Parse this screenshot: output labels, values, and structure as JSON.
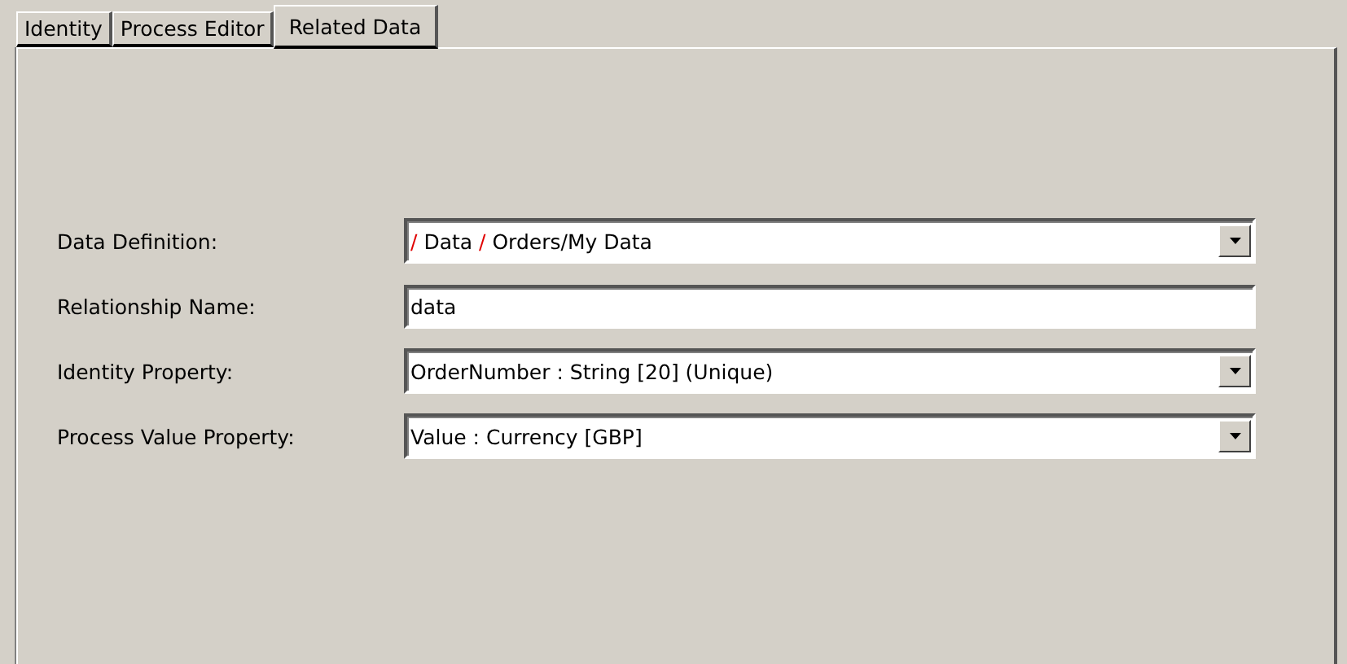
{
  "tabs": [
    {
      "label": "Identity",
      "selected": false
    },
    {
      "label": "Process Editor",
      "selected": false
    },
    {
      "label": "Related Data",
      "selected": true
    }
  ],
  "fields": [
    {
      "kind": "dropdown",
      "label": "Data Definition:",
      "value_parts": [
        {
          "kind": "separator",
          "text": "/"
        },
        {
          "kind": "name",
          "text": " Data "
        },
        {
          "kind": "separator",
          "text": "/"
        },
        {
          "kind": "name",
          "text": " Orders/My Data"
        }
      ]
    },
    {
      "kind": "text",
      "label": "Relationship Name:",
      "value_parts": [
        {
          "kind": "name",
          "text": "data"
        }
      ]
    },
    {
      "kind": "dropdown",
      "label": "Identity Property:",
      "value_parts": [
        {
          "kind": "name",
          "text": "OrderNumber : String [20] (Unique)"
        }
      ]
    },
    {
      "kind": "dropdown",
      "label": "Process Value Property:",
      "value_parts": [
        {
          "kind": "name",
          "text": "Value : Currency [GBP]"
        }
      ]
    }
  ]
}
